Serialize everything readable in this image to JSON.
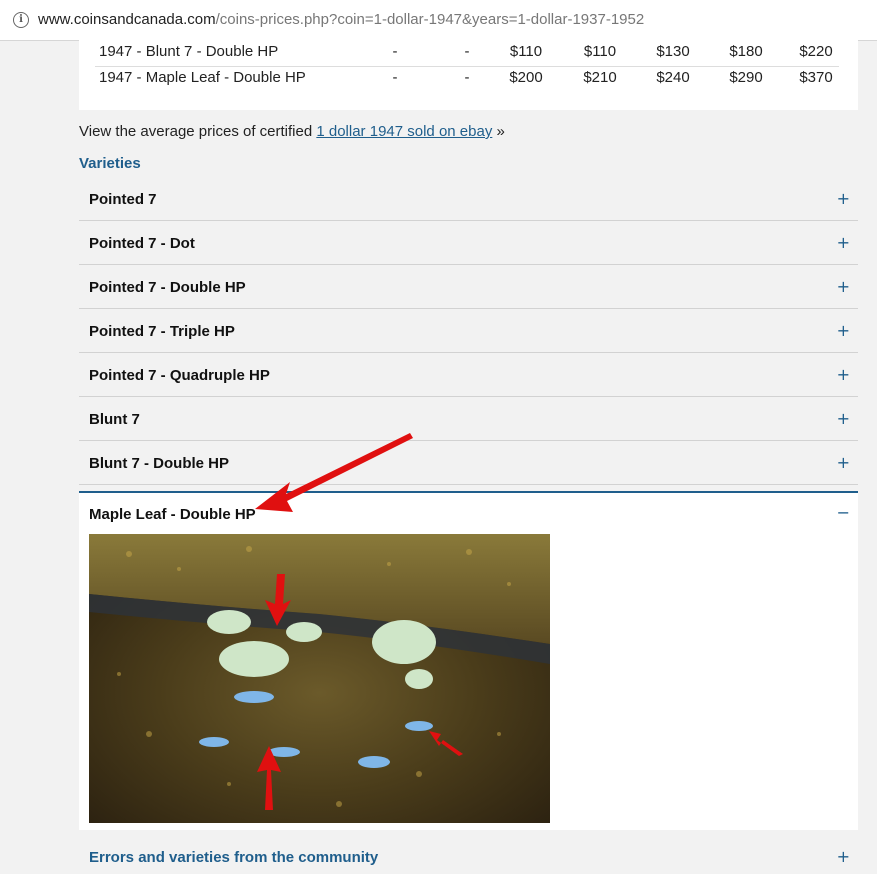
{
  "browser": {
    "url_host": "www.coinsandcanada.com",
    "url_path": "/coins-prices.php?coin=1-dollar-1947&years=1-dollar-1937-1952"
  },
  "price_table": {
    "rows": [
      {
        "name": "1947 - Blunt 7 - Double HP",
        "values": [
          "-",
          "-",
          "$110",
          "$110",
          "$130",
          "$180",
          "$220"
        ]
      },
      {
        "name": "1947 - Maple Leaf - Double HP",
        "values": [
          "-",
          "-",
          "$200",
          "$210",
          "$240",
          "$290",
          "$370"
        ]
      }
    ]
  },
  "ebay": {
    "prefix": "View the average prices of certified ",
    "link": "1 dollar 1947 sold on ebay",
    "suffix": " »"
  },
  "varieties": {
    "title": "Varieties",
    "items": [
      {
        "label": "Pointed 7",
        "toggle": "+"
      },
      {
        "label": "Pointed 7 - Dot",
        "toggle": "+"
      },
      {
        "label": "Pointed 7 - Double HP",
        "toggle": "+"
      },
      {
        "label": "Pointed 7 - Triple HP",
        "toggle": "+"
      },
      {
        "label": "Pointed 7 - Quadruple HP",
        "toggle": "+"
      },
      {
        "label": "Blunt 7",
        "toggle": "+"
      },
      {
        "label": "Blunt 7 - Double HP",
        "toggle": "+"
      }
    ],
    "open_item": {
      "label": "Maple Leaf - Double HP",
      "toggle": "−"
    }
  },
  "community": {
    "label": "Errors and varieties from the community",
    "toggle": "+"
  },
  "colors": {
    "accent": "#1f5e8c",
    "arrow": "#e01010"
  }
}
